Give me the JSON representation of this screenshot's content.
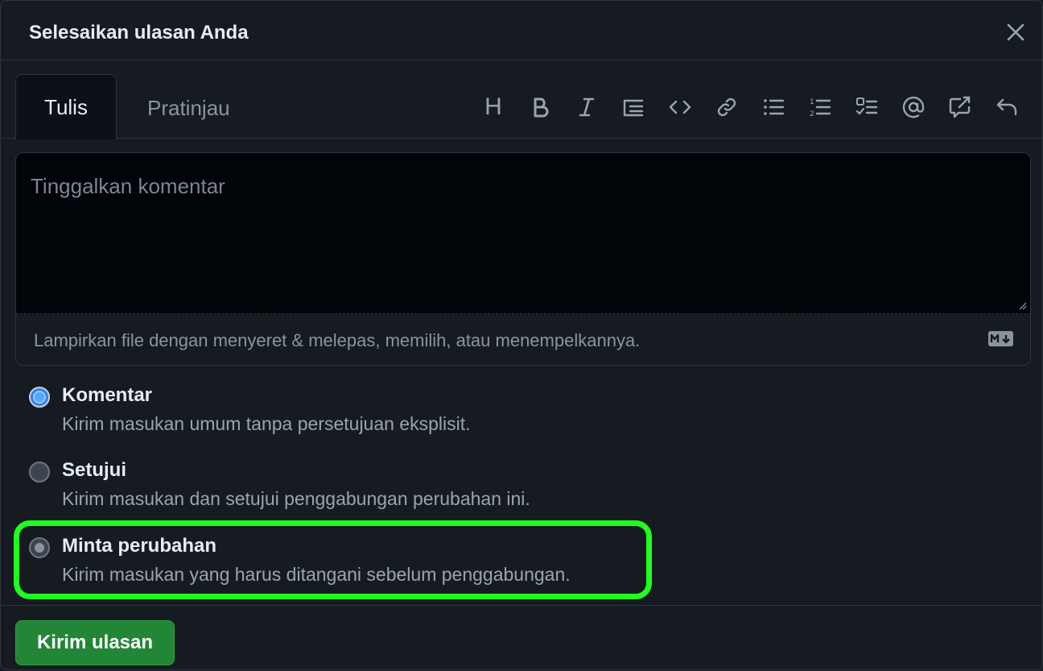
{
  "dialog": {
    "title": "Selesaikan ulasan Anda"
  },
  "tabs": {
    "write": "Tulis",
    "preview": "Pratinjau"
  },
  "toolbar": {
    "heading_label": "H",
    "icons": [
      "heading-icon",
      "bold-icon",
      "italic-icon",
      "quote-icon",
      "code-icon",
      "link-icon",
      "unordered-list-icon",
      "ordered-list-icon",
      "task-list-icon",
      "mention-icon",
      "cross-reference-icon",
      "undo-icon"
    ]
  },
  "editor": {
    "placeholder": "Tinggalkan komentar",
    "attach_hint": "Lampirkan file dengan menyeret & melepas, memilih, atau menempelkannya.",
    "markdown_badge": "markdown-icon"
  },
  "options": [
    {
      "label": "Komentar",
      "description": "Kirim masukan umum tanpa persetujuan eksplisit.",
      "selected": true
    },
    {
      "label": "Setujui",
      "description": "Kirim masukan dan setujui penggabungan perubahan ini.",
      "selected": false
    },
    {
      "label": "Minta perubahan",
      "description": "Kirim masukan yang harus ditangani sebelum penggabungan.",
      "selected": false
    }
  ],
  "footer": {
    "submit_label": "Kirim ulasan"
  },
  "colors": {
    "highlight": "#1fff1f",
    "submit": "#238636",
    "background": "#161b22"
  }
}
